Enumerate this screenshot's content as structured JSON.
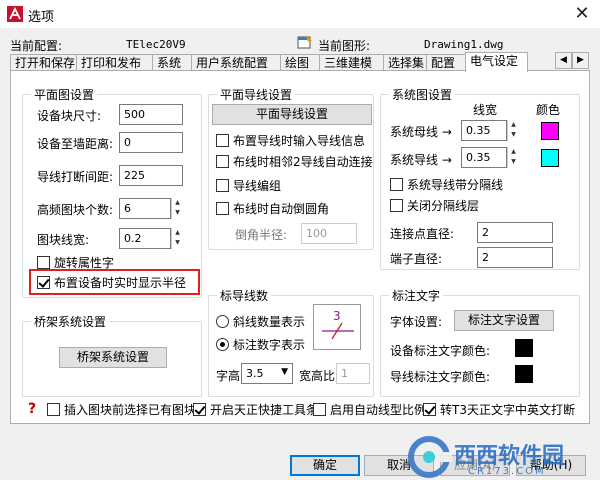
{
  "window": {
    "title": "选项",
    "close": "✕"
  },
  "config": {
    "current_config_label": "当前配置:",
    "current_config_value": "TElec20V9",
    "current_drawing_label": "当前图形:",
    "current_drawing_value": "Drawing1.dwg"
  },
  "tabs": [
    "打开和保存",
    "打印和发布",
    "系统",
    "用户系统配置",
    "绘图",
    "三维建模",
    "选择集",
    "配置",
    "电气设定"
  ],
  "tab_arrows": {
    "left": "◀",
    "right": "▶"
  },
  "plane_settings": {
    "title": "平面图设置",
    "block_size_label": "设备块尺寸:",
    "block_size": "500",
    "wall_dist_label": "设备至墙距离:",
    "wall_dist": "0",
    "break_gap_label": "导线打断间距:",
    "break_gap": "225",
    "hf_count_label": "高频图块个数:",
    "hf_count": "6",
    "block_lw_label": "图块线宽:",
    "block_lw": "0.2",
    "rotate_attr": "旋转属性字",
    "show_radius": "布置设备时实时显示半径"
  },
  "wire_settings": {
    "title": "平面导线设置",
    "btn": "平面导线设置",
    "opt1": "布置导线时输入导线信息",
    "opt2": "布线时相邻2导线自动连接",
    "opt3": "导线编组",
    "opt4": "布线时自动倒圆角",
    "fillet_label": "倒角半径:",
    "fillet_value": "100"
  },
  "system_settings": {
    "title": "系统图设置",
    "lw_header": "线宽",
    "color_header": "颜色",
    "bus_label": "系统母线 →",
    "bus_lw": "0.35",
    "bus_color": "#ff00ff",
    "wire_label": "系统导线 →",
    "wire_lw": "0.35",
    "wire_color": "#00ffff",
    "opt_sep": "系统导线带分隔线",
    "opt_close": "关闭分隔线层",
    "joint_label": "连接点直径:",
    "joint_value": "2",
    "terminal_label": "端子直径:",
    "terminal_value": "2"
  },
  "bridge": {
    "title": "桥架系统设置",
    "btn": "桥架系统设置"
  },
  "wire_count": {
    "title": "标导线数",
    "opt_slash": "斜线数量表示",
    "opt_number": "标注数字表示",
    "preview_num": "3",
    "font_h_label": "字高",
    "font_h": "3.5",
    "ratio_label": "宽高比",
    "ratio": "1"
  },
  "annotation": {
    "title": "标注文字",
    "font_label": "字体设置:",
    "font_btn": "标注文字设置",
    "dev_color_label": "设备标注文字颜色:",
    "dev_color": "#000000",
    "wire_color_label": "导线标注文字颜色:",
    "wire_color": "#000000"
  },
  "bottom_opts": {
    "help": "?",
    "opt1": "插入图块前选择已有图块",
    "opt2": "开启天正快捷工具条",
    "opt3": "启用自动线型比例",
    "opt4": "转T3天正文字中英文打断"
  },
  "buttons": {
    "ok": "确定",
    "cancel": "取消",
    "apply": "应用(A)",
    "help": "帮助(H)"
  },
  "watermark": {
    "text": "西西软件园",
    "url": "CR173.COM"
  }
}
